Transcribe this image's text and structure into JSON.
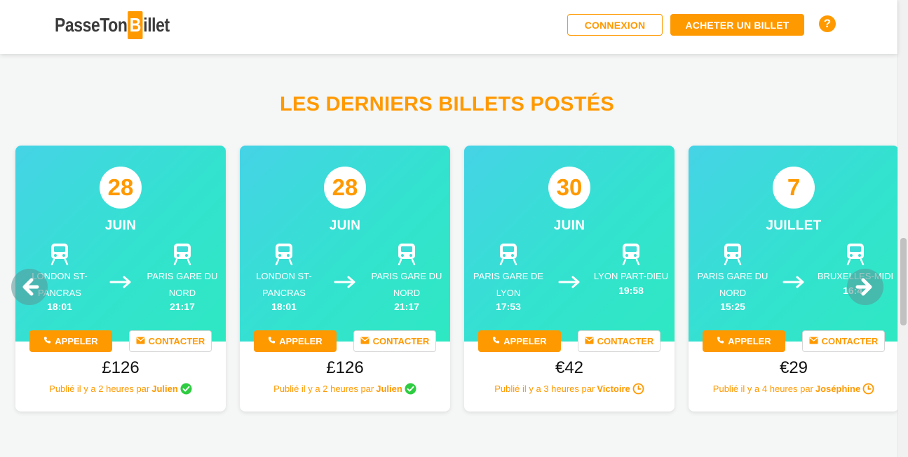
{
  "header": {
    "logo_text_a": "PasseTon",
    "logo_text_b": "B",
    "logo_text_c": "illet",
    "connexion_label": "CONNEXION",
    "acheter_label": "ACHETER UN BILLET",
    "help_label": "?"
  },
  "section": {
    "title": "LES DERNIERS BILLETS POSTÉS"
  },
  "colors": {
    "accent": "#ff9900",
    "card_gradient_start": "#45d3e6",
    "card_gradient_end": "#2ee8c2",
    "verified": "#2ecc40"
  },
  "cards": [
    {
      "day": "28",
      "month": "JUIN",
      "from": "LONDON ST-PANCRAS",
      "from_time": "18:01",
      "to": "PARIS GARE DU NORD",
      "to_time": "21:17",
      "call_label": "APPELER",
      "contact_label": "CONTACTER",
      "price": "£126",
      "posted_prefix": "Publié il y a 2 heures par",
      "posted_by": "Julien",
      "status_icon": "verified-check-icon"
    },
    {
      "day": "28",
      "month": "JUIN",
      "from": "LONDON ST-PANCRAS",
      "from_time": "18:01",
      "to": "PARIS GARE DU NORD",
      "to_time": "21:17",
      "call_label": "APPELER",
      "contact_label": "CONTACTER",
      "price": "£126",
      "posted_prefix": "Publié il y a 2 heures par",
      "posted_by": "Julien",
      "status_icon": "verified-check-icon"
    },
    {
      "day": "30",
      "month": "JUIN",
      "from": "PARIS GARE DE LYON",
      "from_time": "17:53",
      "to": "LYON PART-DIEU",
      "to_time": "19:58",
      "call_label": "APPELER",
      "contact_label": "CONTACTER",
      "price": "€42",
      "posted_prefix": "Publié il y a 3 heures par",
      "posted_by": "Victoire",
      "status_icon": "clock-icon"
    },
    {
      "day": "7",
      "month": "JUILLET",
      "from": "PARIS GARE DU NORD",
      "from_time": "15:25",
      "to": "BRUXELLES-MIDI",
      "to_time": "16:47",
      "call_label": "APPELER",
      "contact_label": "CONTACTER",
      "price": "€29",
      "posted_prefix": "Publié il y a 4 heures par",
      "posted_by": "Joséphine",
      "status_icon": "clock-icon"
    }
  ]
}
